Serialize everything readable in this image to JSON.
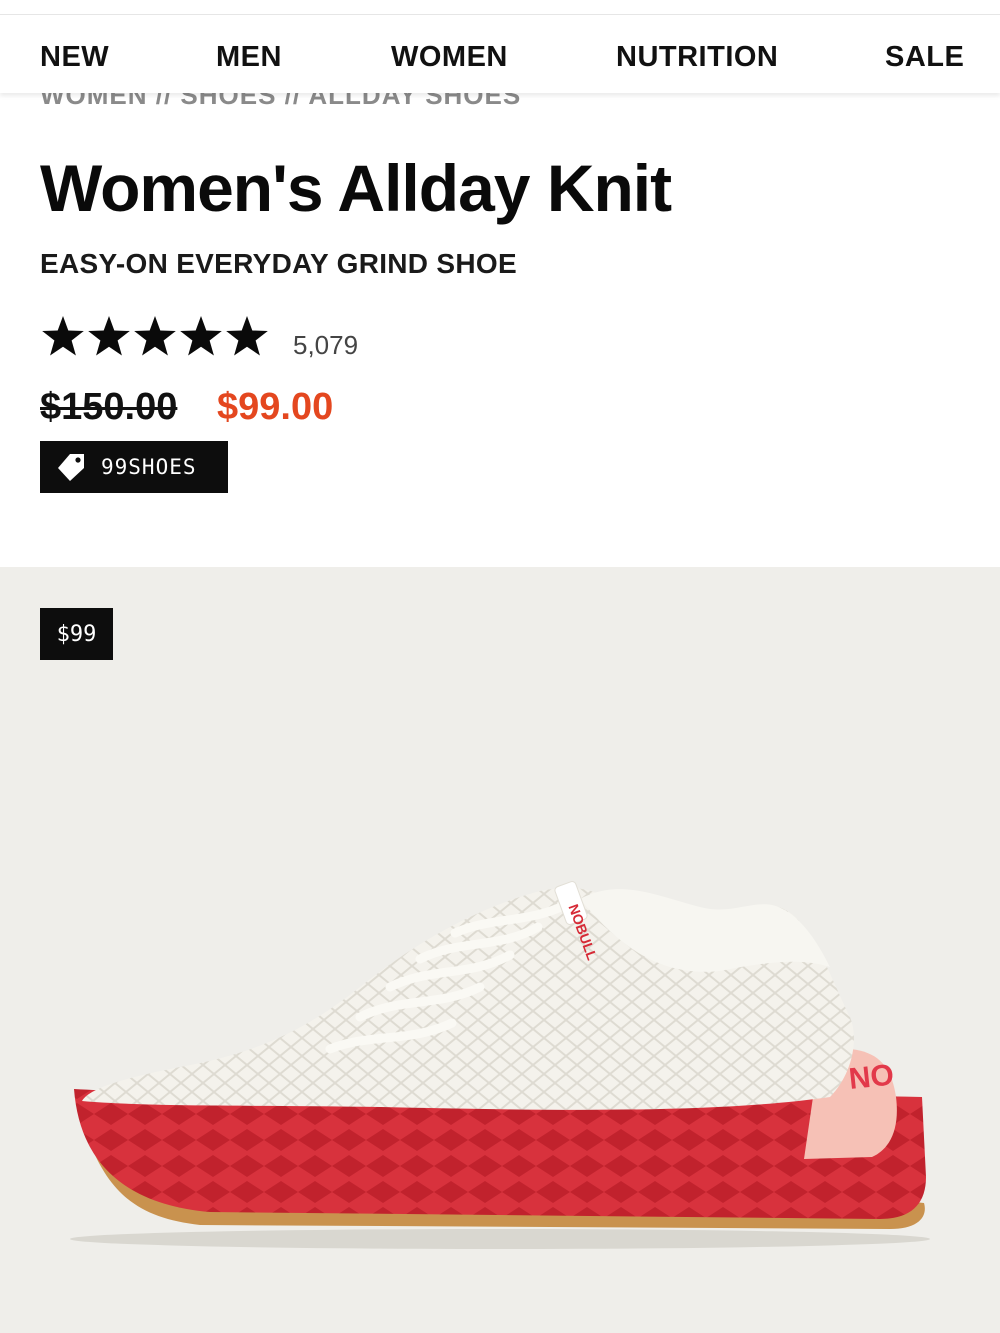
{
  "nav": {
    "items": [
      "NEW",
      "MEN",
      "WOMEN",
      "NUTRITION",
      "SALE"
    ]
  },
  "breadcrumb": "WOMEN // SHOES // ALLDAY SHOES",
  "product": {
    "title": "Women's Allday Knit",
    "subtitle": "EASY-ON EVERYDAY GRIND SHOE",
    "rating_stars": 5,
    "review_count": "5,079",
    "original_price": "$150.00",
    "sale_price": "$99.00",
    "promo_code": "99SHOES",
    "badge_price": "$99",
    "sole_brand_text": "NO",
    "heel_tab_text": "NOBULL"
  },
  "colors": {
    "sale_price": "#e4471f",
    "hero_background": "#efeeea",
    "badge_background": "#0d0d0d",
    "sole": "#d62a36",
    "heel": "#f6c1b6",
    "upper": "#f3f1ea"
  },
  "icons": [
    "star-icon",
    "price-tag-icon"
  ]
}
